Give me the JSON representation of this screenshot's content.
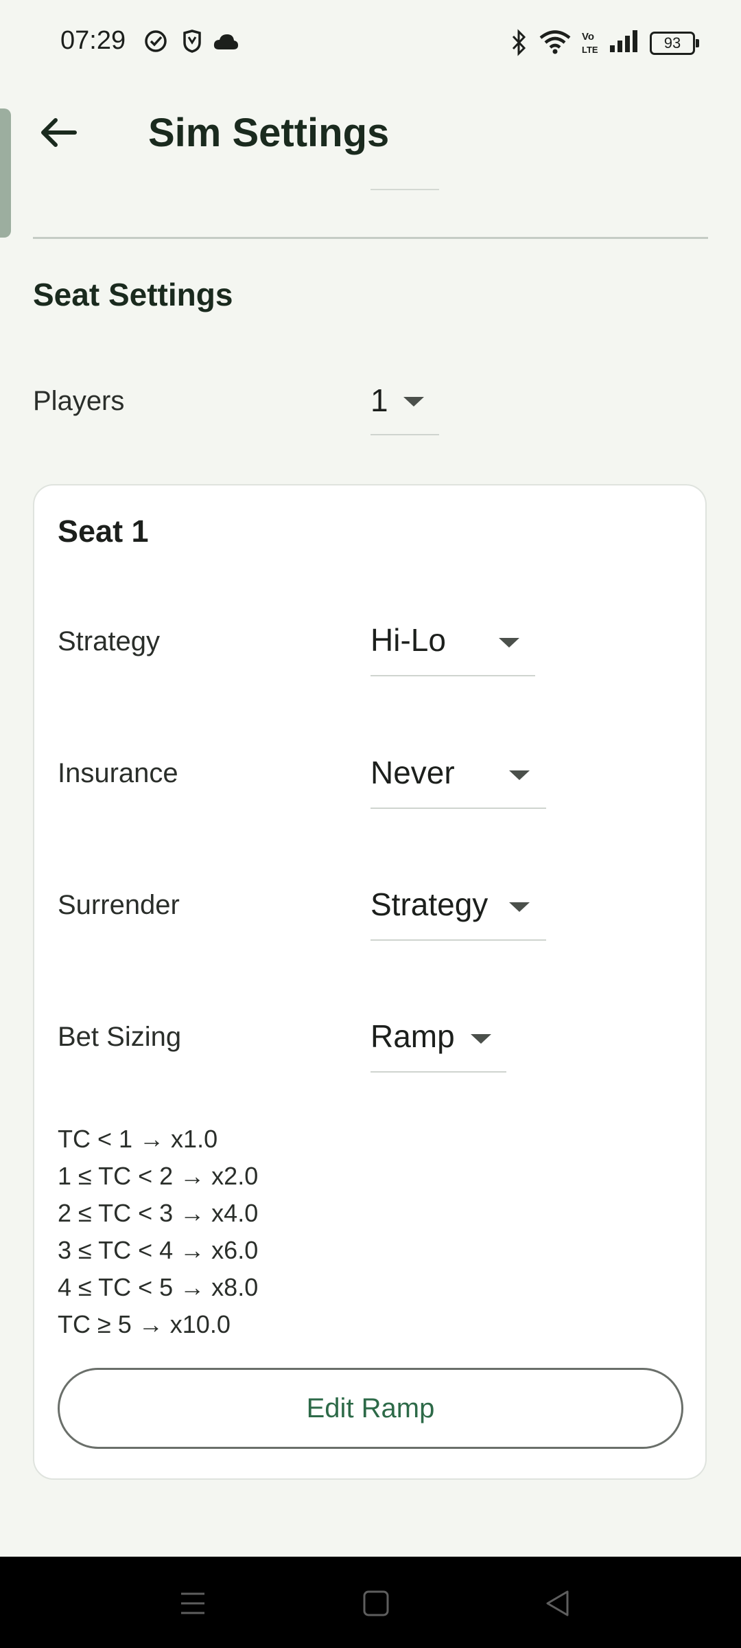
{
  "status": {
    "time": "07:29",
    "battery": "93"
  },
  "appbar": {
    "title": "Sim Settings"
  },
  "seat_settings": {
    "section_title": "Seat Settings",
    "players_label": "Players",
    "players_value": "1"
  },
  "seat": {
    "title": "Seat 1",
    "rows": [
      {
        "label": "Strategy",
        "value": "Hi-Lo"
      },
      {
        "label": "Insurance",
        "value": "Never"
      },
      {
        "label": "Surrender",
        "value": "Strategy"
      },
      {
        "label": "Bet Sizing",
        "value": "Ramp"
      }
    ],
    "ramp": [
      "TC < 1 → x1.0",
      "1 ≤ TC < 2 → x2.0",
      "2 ≤ TC < 3 → x4.0",
      "3 ≤ TC < 4 → x6.0",
      "4 ≤ TC < 5 → x8.0",
      "TC ≥ 5 → x10.0"
    ],
    "edit_button": "Edit Ramp"
  }
}
